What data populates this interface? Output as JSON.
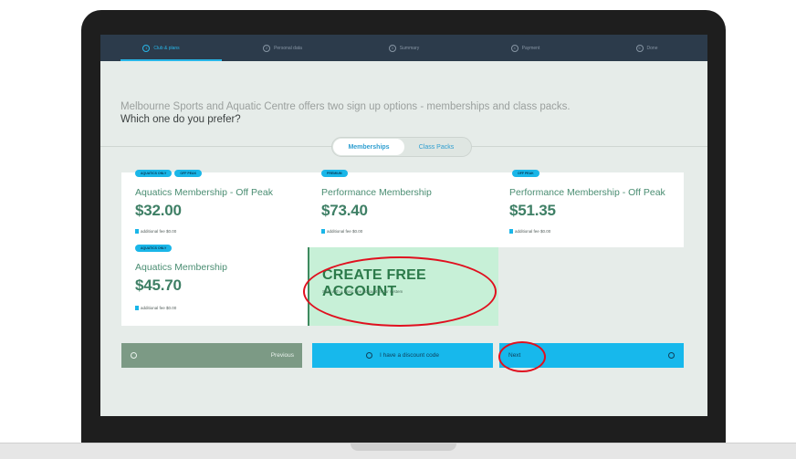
{
  "steps": [
    {
      "label": "Club & plans",
      "num": "1",
      "active": true
    },
    {
      "label": "Personal data",
      "num": "2",
      "active": false
    },
    {
      "label": "Summary",
      "num": "3",
      "active": false
    },
    {
      "label": "Payment",
      "num": "4",
      "active": false
    },
    {
      "label": "Done",
      "num": "5",
      "active": false
    }
  ],
  "intro": {
    "line1": "Melbourne Sports and Aquatic Centre offers two sign up options - memberships and class packs.",
    "line2": "Which one do you prefer?"
  },
  "toggle": {
    "selected": "Memberships",
    "other": "Class Packs"
  },
  "cards": [
    {
      "badges": [
        "AQUATICS ONLY",
        "OFF PEAK"
      ],
      "name": "Aquatics Membership - Off Peak",
      "price": "$32.00",
      "fee": "additional fee $0.00"
    },
    {
      "badges": [
        "PREMIUM"
      ],
      "name": "Performance Membership",
      "price": "$73.40",
      "fee": "additional fee $0.00"
    },
    {
      "badges": [
        "OFF PEAK"
      ],
      "name": "Performance Membership - Off Peak",
      "price": "$51.35",
      "fee": "additional fee $0.00"
    },
    {
      "badges": [
        "AQUATICS ONLY"
      ],
      "name": "Aquatics Membership",
      "price": "$45.70",
      "fee": "additional fee $0.00"
    }
  ],
  "free_account": {
    "title": "CREATE FREE ACCOUNT",
    "subtitle": "Start with a basic free account in our system"
  },
  "buttons": {
    "previous": "Previous",
    "discount": "I have a discount code",
    "next": "Next"
  },
  "colors": {
    "accent": "#17b8ec",
    "nav": "#2c3b4b",
    "highlight": "#e0101f",
    "price": "#3e7f65",
    "free_bg": "#c7f0d7"
  }
}
